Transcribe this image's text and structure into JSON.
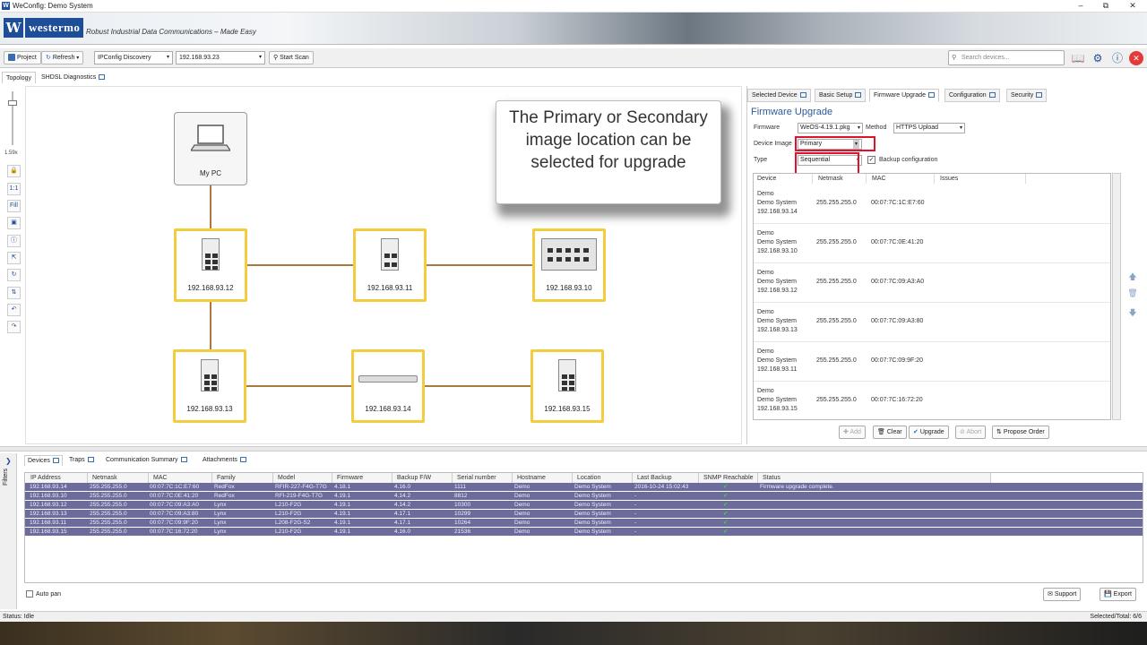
{
  "window": {
    "title": "WeConfig: Demo System",
    "app_icon": "W"
  },
  "brand": {
    "logo_letter": "W",
    "logo_text": "westermo",
    "tagline": "Robust Industrial Data Communications – Made Easy"
  },
  "toolbar": {
    "project": "Project",
    "refresh": "Refresh",
    "discovery": "IPConfig Discovery",
    "ip": "192.168.93.23",
    "start_scan": "Start Scan",
    "search_placeholder": "Search devices..."
  },
  "left_tabs": [
    "Topology",
    "SHDSL Diagnostics"
  ],
  "zoom": "1.59x",
  "tools": [
    "🔒",
    "1:1",
    "Fill",
    "▣",
    "ⓘ",
    "⇱",
    "↻",
    "⇅",
    "↶",
    "↷"
  ],
  "topology": {
    "pc_label": "My PC",
    "nodes": [
      "192.168.93.12",
      "192.168.93.11",
      "192.168.93.10",
      "192.168.93.13",
      "192.168.93.14",
      "192.168.93.15"
    ]
  },
  "callout": {
    "text": "The Primary or Secondary image location can be selected for upgrade"
  },
  "right_tabs": [
    "Selected Device",
    "Basic Setup",
    "Firmware Upgrade",
    "Configuration",
    "Security"
  ],
  "firmware": {
    "title": "Firmware Upgrade",
    "firmware_label": "Firmware",
    "firmware_value": "WeOS-4.19.1.pkg",
    "method_label": "Method",
    "method_value": "HTTPS Upload",
    "image_label": "Device Image",
    "image_value": "Primary",
    "type_label": "Type",
    "type_value": "Sequential",
    "backup_label": "Backup configuration",
    "columns": [
      "Device",
      "Netmask",
      "MAC",
      "Issues"
    ],
    "rows": [
      {
        "l1": "Demo",
        "l2": "Demo System",
        "ip": "192.168.93.14",
        "mask": "255.255.255.0",
        "mac": "00:07:7C:1C:E7:60"
      },
      {
        "l1": "Demo",
        "l2": "Demo System",
        "ip": "192.168.93.10",
        "mask": "255.255.255.0",
        "mac": "00:07:7C:0E:41:20"
      },
      {
        "l1": "Demo",
        "l2": "Demo System",
        "ip": "192.168.93.12",
        "mask": "255.255.255.0",
        "mac": "00:07:7C:09:A3:A0"
      },
      {
        "l1": "Demo",
        "l2": "Demo System",
        "ip": "192.168.93.13",
        "mask": "255.255.255.0",
        "mac": "00:07:7C:09:A3:80"
      },
      {
        "l1": "Demo",
        "l2": "Demo System",
        "ip": "192.168.93.11",
        "mask": "255.255.255.0",
        "mac": "00:07:7C:09:9F:20"
      },
      {
        "l1": "Demo",
        "l2": "Demo System",
        "ip": "192.168.93.15",
        "mask": "255.255.255.0",
        "mac": "00:07:7C:16:72:20"
      }
    ],
    "buttons": {
      "add": "Add",
      "clear": "Clear",
      "upgrade": "Upgrade",
      "abort": "Abort",
      "propose": "Propose Order"
    }
  },
  "bottom_tabs": [
    "Devices",
    "Traps",
    "Communication Summary",
    "Attachments"
  ],
  "filters_label": "Filters",
  "grid": {
    "columns": [
      "IP Address",
      "Netmask",
      "MAC",
      "Family",
      "Model",
      "Firmware",
      "Backup F/W",
      "Serial number",
      "Hostname",
      "Location",
      "Last Backup",
      "SNMP Reachable",
      "Status"
    ],
    "rows": [
      [
        "192.168.93.14",
        "255.255.255.0",
        "00:07:7C:1C:E7:60",
        "RedFox",
        "RFIR-227-F4G-T7G",
        "4.18.1",
        "4.16.0",
        "1111",
        "Demo",
        "Demo System",
        "2016-10-24 15:02:43",
        "✔",
        "Firmware upgrade complete."
      ],
      [
        "192.168.93.10",
        "255.255.255.0",
        "00:07:7C:0E:41:20",
        "RedFox",
        "RFI-219-F4G-T7G",
        "4.19.1",
        "4.14.2",
        "8812",
        "Demo",
        "Demo System",
        "-",
        "✔",
        ""
      ],
      [
        "192.168.93.12",
        "255.255.255.0",
        "00:07:7C:09:A3:A0",
        "Lynx",
        "L210-F2G",
        "4.19.1",
        "4.14.2",
        "10300",
        "Demo",
        "Demo System",
        "-",
        "✔",
        ""
      ],
      [
        "192.168.93.13",
        "255.255.255.0",
        "00:07:7C:09:A3:80",
        "Lynx",
        "L210-F2G",
        "4.19.1",
        "4.17.1",
        "10299",
        "Demo",
        "Demo System",
        "-",
        "✔",
        ""
      ],
      [
        "192.168.93.11",
        "255.255.255.0",
        "00:07:7C:09:9F:20",
        "Lynx",
        "L208-F2G-S2",
        "4.19.1",
        "4.17.1",
        "10264",
        "Demo",
        "Demo System",
        "-",
        "✔",
        ""
      ],
      [
        "192.168.93.15",
        "255.255.255.0",
        "00:07:7C:16:72:20",
        "Lynx",
        "L210-F2G",
        "4.19.1",
        "4.16.0",
        "21536",
        "Demo",
        "Demo System",
        "-",
        "✔",
        ""
      ]
    ]
  },
  "auto_pan": "Auto pan",
  "support": "Support",
  "export": "Export",
  "status": {
    "left": "Status: Idle",
    "right": "Selected/Total: 6/6"
  },
  "colors": {
    "accent": "#1f4e98",
    "node_border": "#f4cc3f",
    "link": "#a97a3c",
    "highlight": "#e0122b",
    "row_selected": "#6b6b9c"
  }
}
